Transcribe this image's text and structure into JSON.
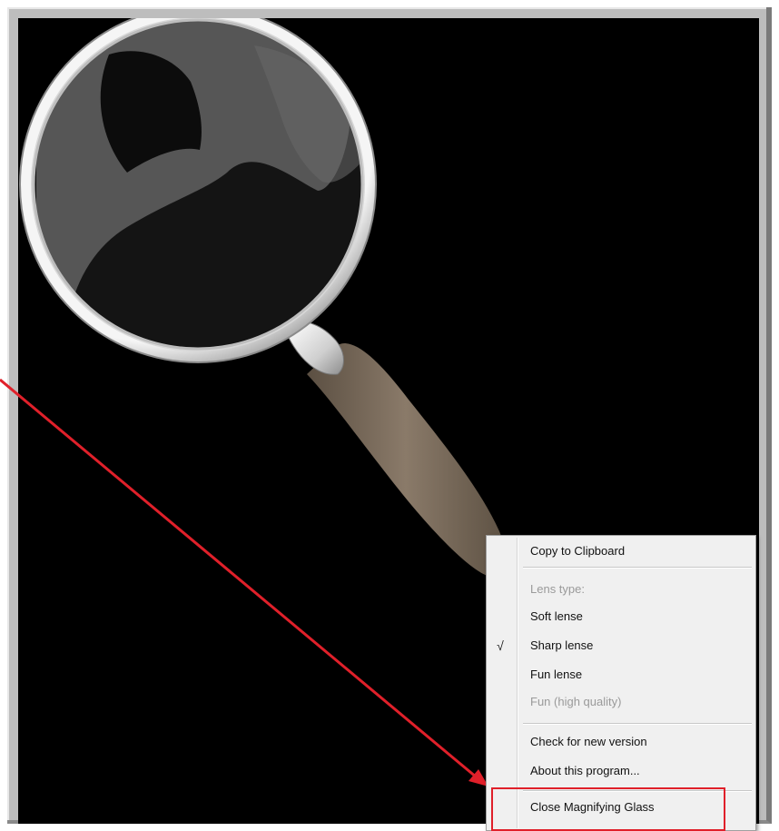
{
  "context_menu": {
    "items": [
      {
        "label": "Copy to Clipboard",
        "enabled": true,
        "checked": false
      },
      {
        "label": "Lens type:",
        "enabled": false,
        "checked": false
      },
      {
        "label": "Soft lense",
        "enabled": true,
        "checked": false
      },
      {
        "label": "Sharp lense",
        "enabled": true,
        "checked": true
      },
      {
        "label": "Fun lense",
        "enabled": true,
        "checked": false
      },
      {
        "label": "Fun (high quality)",
        "enabled": false,
        "checked": false
      },
      {
        "label": "Check for new version",
        "enabled": true,
        "checked": false
      },
      {
        "label": "About this program...",
        "enabled": true,
        "checked": false
      },
      {
        "label": "Close Magnifying Glass",
        "enabled": true,
        "checked": false
      }
    ],
    "check_glyph": "√"
  },
  "annotation": {
    "color": "#e0202a",
    "highlighted_item": "Close Magnifying Glass"
  },
  "glass": {
    "rim_color": "#e6e6e6",
    "handle_color": "#7d6e5e",
    "lens_color": "#1c1c1c"
  }
}
